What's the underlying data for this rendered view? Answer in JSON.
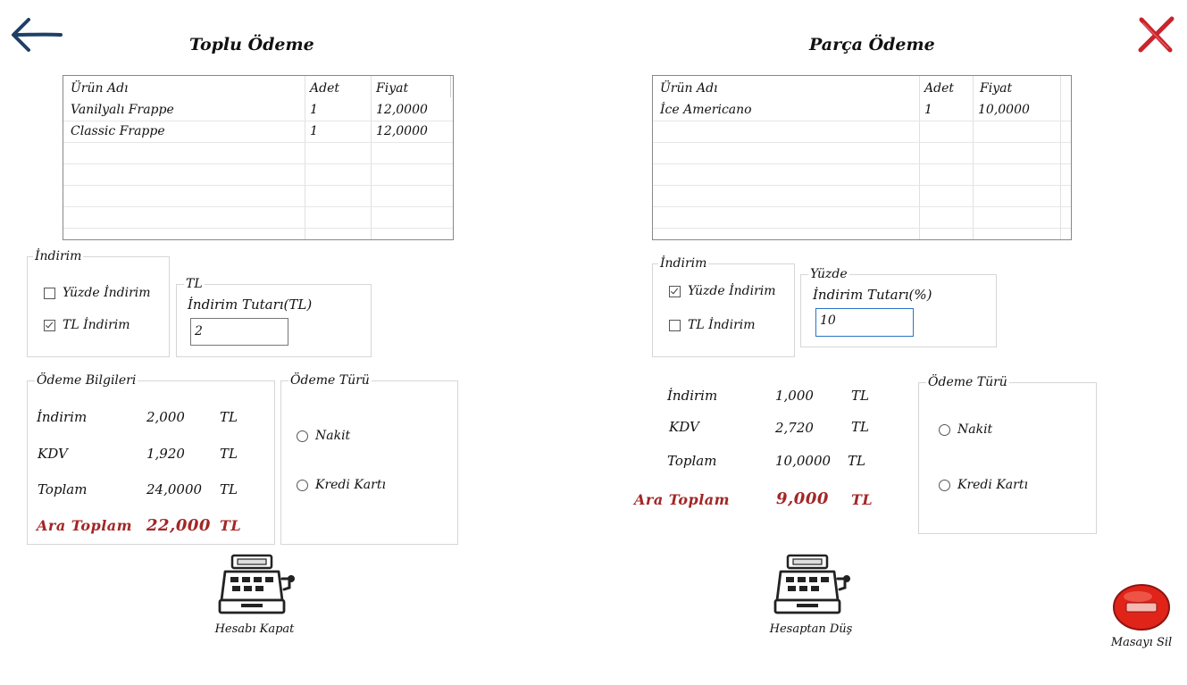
{
  "left": {
    "title": "Toplu Ödeme",
    "columns": [
      "Ürün Adı",
      "Adet",
      "Fiyat"
    ],
    "rows": [
      [
        "Vanilyalı Frappe",
        "1",
        "12,0000"
      ],
      [
        "Classic Frappe",
        "1",
        "12,0000"
      ]
    ],
    "discount_group": "İndirim",
    "percent_discount_label": "Yüzde İndirim",
    "tl_discount_label": "TL İndirim",
    "amount_group": "TL",
    "amount_label": "İndirim Tutarı(TL)",
    "amount_value": "2",
    "payment_info_group": "Ödeme Bilgileri",
    "summary": {
      "discount_label": "İndirim",
      "discount_value": "2,000",
      "discount_unit": "TL",
      "kdv_label": "KDV",
      "kdv_value": "1,920",
      "kdv_unit": "TL",
      "total_label": "Toplam",
      "total_value": "24,0000",
      "total_unit": "TL",
      "subtotal_label": "Ara Toplam",
      "subtotal_value": "22,000",
      "subtotal_unit": "TL"
    },
    "payment_type_group": "Ödeme Türü",
    "cash_label": "Nakit",
    "card_label": "Kredi Kartı",
    "action_label": "Hesabı Kapat"
  },
  "right": {
    "title": "Parça Ödeme",
    "columns": [
      "Ürün Adı",
      "Adet",
      "Fiyat"
    ],
    "rows": [
      [
        "İce Americano",
        "1",
        "10,0000"
      ]
    ],
    "discount_group": "İndirim",
    "percent_discount_label": "Yüzde İndirim",
    "tl_discount_label": "TL İndirim",
    "amount_group": "Yüzde",
    "amount_label": "İndirim Tutarı(%)",
    "amount_value": "10",
    "summary": {
      "discount_label": "İndirim",
      "discount_value": "1,000",
      "discount_unit": "TL",
      "kdv_label": "KDV",
      "kdv_value": "2,720",
      "kdv_unit": "TL",
      "total_label": "Toplam",
      "total_value": "10,0000",
      "total_unit": "TL",
      "subtotal_label": "Ara Toplam",
      "subtotal_value": "9,000",
      "subtotal_unit": "TL"
    },
    "payment_type_group": "Ödeme Türü",
    "cash_label": "Nakit",
    "card_label": "Kredi Kartı",
    "action_label": "Hesaptan Düş"
  },
  "delete_table_label": "Masayı Sil",
  "colors": {
    "accent_red": "#a32626",
    "back_arrow": "#1f3f66",
    "close_red": "#c9232b",
    "delete_red": "#e0241a"
  }
}
